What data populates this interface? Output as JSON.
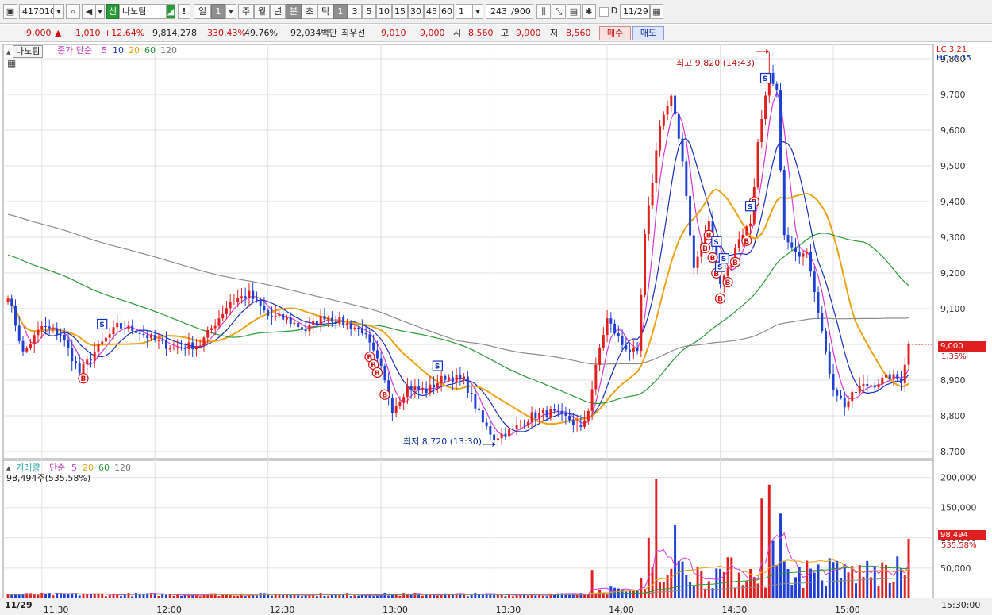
{
  "toolbar": {
    "code": "417010",
    "market_badge": "신",
    "name": "나노팀",
    "alert_label": "!",
    "period_labels": [
      "일",
      "1",
      "주",
      "월",
      "년",
      "분",
      "초",
      "틱"
    ],
    "minute_labels": [
      "1",
      "3",
      "5",
      "10",
      "15",
      "30",
      "45",
      "60"
    ],
    "multiplier": "1",
    "count": "243",
    "count_max": "/900",
    "d_label": "D",
    "date": "11/29",
    "colors": {
      "up": "#e02020",
      "down": "#1f3fd6",
      "accent": "#2a5db0"
    }
  },
  "quote": {
    "price": "9,000",
    "change": "1,010",
    "change_pct": "+12.64%",
    "volume": "9,814,278",
    "volume_ratio": "330.43%",
    "turnover": "49.76%",
    "amount": "92,034백만",
    "best_label": "최우선",
    "best_ask": "9,010",
    "best_bid": "9,000",
    "open_label": "시",
    "open": "8,560",
    "high_label": "고",
    "high": "9,900",
    "low_label": "저",
    "low": "8,560",
    "buy_label": "매수",
    "sell_label": "매도"
  },
  "price_panel": {
    "name_tag": "나노팀",
    "legend_prefix": "종가 단순",
    "ma_periods": [
      "5",
      "10",
      "20",
      "60",
      "120"
    ],
    "lc": "LC:3.21",
    "hc": "HC:-8.35",
    "high_annotation": "최고 9,820 (14:43)",
    "low_annotation": "최저 8,720 (13:30)",
    "current_price_label": "9,000",
    "current_pct_label": "1.35%",
    "y_ticks": [
      "9,800",
      "9,700",
      "9,600",
      "9,500",
      "9,400",
      "9,300",
      "9,200",
      "9,100",
      "9,000",
      "8,900",
      "8,800",
      "8,700"
    ]
  },
  "volume_panel": {
    "legend_prefix": "거래량",
    "legend_type": "단순",
    "ma_periods": [
      "5",
      "20",
      "60",
      "120"
    ],
    "current_line": "98,494주(535.58%)",
    "current_label": "98,494",
    "current_pct_label": "535.58%",
    "y_ticks": [
      "200,000",
      "150,000",
      "100,000",
      "50,000"
    ]
  },
  "x_axis": {
    "date_label": "11/29",
    "ticks": [
      "11:30",
      "12:00",
      "12:30",
      "13:00",
      "13:30",
      "14:00",
      "14:30",
      "15:00"
    ],
    "right_label": "15:30:00"
  },
  "chart_data": {
    "type": "candlestick",
    "interval_minutes": 1,
    "x_labels": [
      "11:30",
      "12:00",
      "12:30",
      "13:00",
      "13:30",
      "14:00",
      "14:30",
      "15:00"
    ],
    "price_ylim": [
      8680,
      9840
    ],
    "volume_ylim": [
      0,
      210000
    ],
    "high": {
      "price": 9820,
      "time": "14:43"
    },
    "low": {
      "price": 8720,
      "time": "13:30"
    },
    "last_price": 9000,
    "last_volume": 98494,
    "close_path": [
      {
        "t": "11:21",
        "c": 9140
      },
      {
        "t": "11:25",
        "c": 8975
      },
      {
        "t": "11:30",
        "c": 9050
      },
      {
        "t": "11:35",
        "c": 9030
      },
      {
        "t": "11:40",
        "c": 8920
      },
      {
        "t": "11:44",
        "c": 8980
      },
      {
        "t": "11:50",
        "c": 9050
      },
      {
        "t": "11:55",
        "c": 9040
      },
      {
        "t": "12:00",
        "c": 9010
      },
      {
        "t": "12:05",
        "c": 8990
      },
      {
        "t": "12:12",
        "c": 9000
      },
      {
        "t": "12:20",
        "c": 9120
      },
      {
        "t": "12:25",
        "c": 9140
      },
      {
        "t": "12:30",
        "c": 9080
      },
      {
        "t": "12:35",
        "c": 9070
      },
      {
        "t": "12:40",
        "c": 9040
      },
      {
        "t": "12:45",
        "c": 9080
      },
      {
        "t": "12:50",
        "c": 9060
      },
      {
        "t": "12:55",
        "c": 9040
      },
      {
        "t": "13:00",
        "c": 8930
      },
      {
        "t": "13:03",
        "c": 8820
      },
      {
        "t": "13:07",
        "c": 8880
      },
      {
        "t": "13:12",
        "c": 8870
      },
      {
        "t": "13:17",
        "c": 8910
      },
      {
        "t": "13:22",
        "c": 8900
      },
      {
        "t": "13:27",
        "c": 8780
      },
      {
        "t": "13:30",
        "c": 8740
      },
      {
        "t": "13:35",
        "c": 8760
      },
      {
        "t": "13:40",
        "c": 8800
      },
      {
        "t": "13:45",
        "c": 8810
      },
      {
        "t": "13:50",
        "c": 8790
      },
      {
        "t": "13:53",
        "c": 8760
      },
      {
        "t": "13:55",
        "c": 8820
      },
      {
        "t": "13:58",
        "c": 8990
      },
      {
        "t": "14:00",
        "c": 9070
      },
      {
        "t": "14:04",
        "c": 9000
      },
      {
        "t": "14:08",
        "c": 8970
      },
      {
        "t": "14:10",
        "c": 9300
      },
      {
        "t": "14:14",
        "c": 9620
      },
      {
        "t": "14:17",
        "c": 9690
      },
      {
        "t": "14:20",
        "c": 9520
      },
      {
        "t": "14:23",
        "c": 9210
      },
      {
        "t": "14:25",
        "c": 9280
      },
      {
        "t": "14:27",
        "c": 9340
      },
      {
        "t": "14:30",
        "c": 9180
      },
      {
        "t": "14:33",
        "c": 9230
      },
      {
        "t": "14:35",
        "c": 9300
      },
      {
        "t": "14:38",
        "c": 9340
      },
      {
        "t": "14:40",
        "c": 9560
      },
      {
        "t": "14:43",
        "c": 9750
      },
      {
        "t": "14:45",
        "c": 9700
      },
      {
        "t": "14:47",
        "c": 9300
      },
      {
        "t": "14:50",
        "c": 9250
      },
      {
        "t": "14:53",
        "c": 9270
      },
      {
        "t": "14:56",
        "c": 9100
      },
      {
        "t": "14:58",
        "c": 8970
      },
      {
        "t": "15:00",
        "c": 8880
      },
      {
        "t": "15:03",
        "c": 8830
      },
      {
        "t": "15:07",
        "c": 8880
      },
      {
        "t": "15:11",
        "c": 8890
      },
      {
        "t": "15:15",
        "c": 8910
      },
      {
        "t": "15:18",
        "c": 8900
      },
      {
        "t": "15:20",
        "c": 9000
      }
    ],
    "volume_spikes": [
      {
        "t": "14:13",
        "v": 198000
      },
      {
        "t": "14:43",
        "v": 188000
      },
      {
        "t": "14:41",
        "v": 165000
      },
      {
        "t": "14:46",
        "v": 140000
      },
      {
        "t": "14:18",
        "v": 122000
      },
      {
        "t": "14:11",
        "v": 100000
      },
      {
        "t": "14:44",
        "v": 95000
      },
      {
        "t": "15:20",
        "v": 98494
      },
      {
        "t": "13:56",
        "v": 47000
      }
    ],
    "series": [
      {
        "name": "5",
        "color": "#d63ad6",
        "smoothing": 5
      },
      {
        "name": "10",
        "color": "#1c2fb8",
        "smoothing": 10
      },
      {
        "name": "20",
        "color": "#e8a317",
        "smoothing": 20
      },
      {
        "name": "60",
        "color": "#2a9a3a",
        "smoothing": 60
      },
      {
        "name": "120",
        "color": "#8c8c8c",
        "smoothing": 120
      }
    ],
    "markers": {
      "buy": [
        "11:41",
        "12:57",
        "12:58",
        "12:59",
        "13:01",
        "14:26",
        "14:27",
        "14:28",
        "14:29",
        "14:30",
        "14:32",
        "14:34",
        "14:37",
        "14:39"
      ],
      "sell": [
        "11:46",
        "13:15",
        "14:29",
        "14:30",
        "14:31",
        "14:38",
        "14:42"
      ]
    }
  }
}
